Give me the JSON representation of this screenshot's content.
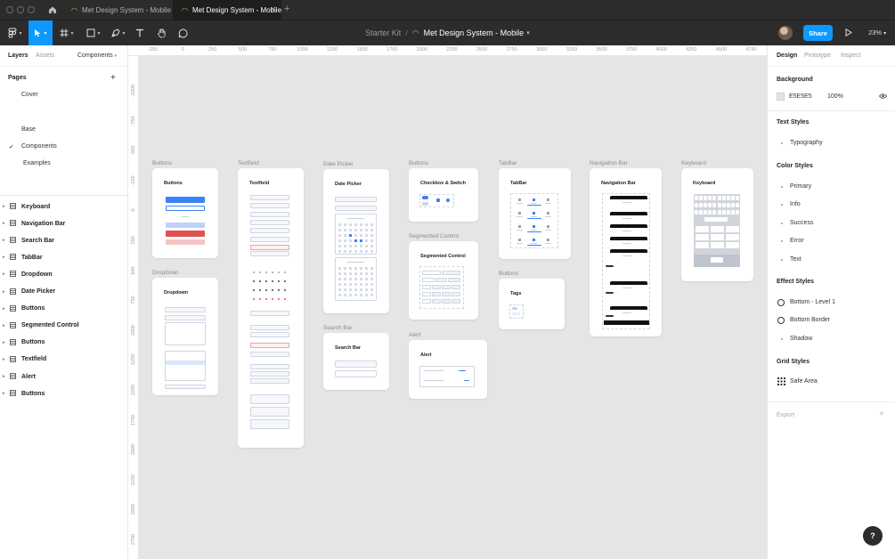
{
  "tabs": [
    {
      "label": "Met Design System - Mobile",
      "active": false
    },
    {
      "label": "Met Design System - Mobile",
      "active": true
    }
  ],
  "breadcrumb": {
    "project": "Starter Kit",
    "separator": "/",
    "file": "Met Design System - Mobile"
  },
  "toolbar": {
    "share_label": "Share",
    "zoom": "23%"
  },
  "left_panel": {
    "tabs": [
      "Layers",
      "Assets"
    ],
    "components_label": "Components",
    "pages_label": "Pages",
    "pages": [
      {
        "label": "Cover",
        "current": false
      },
      {
        "label": "Base",
        "current": false
      },
      {
        "label": "Components",
        "current": true
      },
      {
        "label": "Examples",
        "current": false
      }
    ],
    "layers": [
      "Keyboard",
      "Navigation Bar",
      "Search Bar",
      "TabBar",
      "Dropdown",
      "Date Picker",
      "Buttons",
      "Segmented Control",
      "Buttons",
      "Textfield",
      "Alert",
      "Buttons"
    ]
  },
  "ruler": {
    "top": [
      "-250",
      "0",
      "250",
      "500",
      "750",
      "1000",
      "1250",
      "1500",
      "1750",
      "2000",
      "2250",
      "2500",
      "2750",
      "3000",
      "3250",
      "3500",
      "3750",
      "4000",
      "4250",
      "4500",
      "4750"
    ],
    "left": [
      "-1000",
      "-750",
      "-500",
      "-250",
      "0",
      "250",
      "500",
      "750",
      "1000",
      "1250",
      "1500",
      "1750",
      "2000",
      "2250",
      "2500",
      "2750"
    ]
  },
  "canvas": {
    "frames": [
      {
        "label": "Buttons",
        "title": "Buttons"
      },
      {
        "label": "Dropdown",
        "title": "Dropdown"
      },
      {
        "label": "Textfield",
        "title": "Textfield"
      },
      {
        "label": "Date Picker",
        "title": "Date Picker"
      },
      {
        "label": "Search Bar",
        "title": "Search Bar"
      },
      {
        "label": "Buttons",
        "title": "Checkbox & Switch"
      },
      {
        "label": "Segmented Control",
        "title": "Segmented Control"
      },
      {
        "label": "Alert",
        "title": "Alert"
      },
      {
        "label": "TabBar",
        "title": "TabBar"
      },
      {
        "label": "Buttons",
        "title": "Tags"
      },
      {
        "label": "Navigation Bar",
        "title": "Navigation Bar"
      },
      {
        "label": "Keyboard",
        "title": "Keyboard"
      }
    ]
  },
  "right_panel": {
    "tabs": [
      "Design",
      "Prototype",
      "Inspect"
    ],
    "background_label": "Background",
    "background_hex": "E5E5E5",
    "background_opacity": "100%",
    "text_styles_label": "Text Styles",
    "text_styles": [
      "Typography"
    ],
    "color_styles_label": "Color Styles",
    "color_styles": [
      "Primary",
      "Info",
      "Success",
      "Error",
      "Text"
    ],
    "effect_styles_label": "Effect Styles",
    "effect_styles": [
      "Bottom - Level 1",
      "Bottom Border",
      "Shadow"
    ],
    "grid_styles_label": "Grid Styles",
    "grid_styles": [
      "Safe Area"
    ],
    "export_label": "Export"
  },
  "help_label": "?",
  "colors": {
    "accent": "#0d99ff",
    "canvas": "#e5e5e5",
    "toolbar": "#2c2c2c",
    "primary": "#3b82f6",
    "error": "#e05252"
  }
}
